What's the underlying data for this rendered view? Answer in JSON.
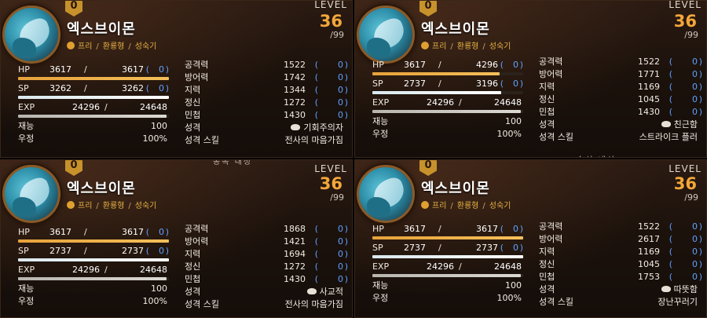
{
  "panels": [
    {
      "name": "엑스브이몬",
      "badge": "0",
      "tags": [
        "프리",
        "환룡형",
        "성숙기"
      ],
      "level_label": "LEVEL",
      "level": "36",
      "level_max": "/99",
      "hp": {
        "label": "HP",
        "cur": "3617",
        "max": "3617",
        "plus": "0",
        "fill": 1.0
      },
      "sp": {
        "label": "SP",
        "cur": "3262",
        "max": "3262",
        "plus": "0",
        "fill": 1.0
      },
      "exp": {
        "label": "EXP",
        "cur": "24296",
        "max": "24648",
        "fill": 0.986
      },
      "talent": {
        "label": "재능",
        "value": "100"
      },
      "friendship": {
        "label": "우정",
        "value": "100%"
      },
      "stats": [
        {
          "label": "공격력",
          "value": "1522",
          "plus": "0"
        },
        {
          "label": "방어력",
          "value": "1742",
          "plus": "0"
        },
        {
          "label": "지력",
          "value": "1344",
          "plus": "0"
        },
        {
          "label": "정신",
          "value": "1272",
          "plus": "0"
        },
        {
          "label": "민첩",
          "value": "1430",
          "plus": "0"
        }
      ],
      "personality": {
        "label": "성격",
        "value": "기회주의자"
      },
      "personality_skill": {
        "label": "성격 스킬",
        "value": "전사의 마음가짐"
      },
      "footer_text": ""
    },
    {
      "name": "엑스브이몬",
      "badge": "0",
      "tags": [
        "프리",
        "환룡형",
        "성숙기"
      ],
      "level_label": "LEVEL",
      "level": "36",
      "level_max": "/99",
      "hp": {
        "label": "HP",
        "cur": "3617",
        "max": "4296",
        "plus": "0",
        "fill": 0.842
      },
      "sp": {
        "label": "SP",
        "cur": "2737",
        "max": "3196",
        "plus": "0",
        "fill": 0.856
      },
      "exp": {
        "label": "EXP",
        "cur": "24296",
        "max": "24648",
        "fill": 0.986
      },
      "talent": {
        "label": "재능",
        "value": "100"
      },
      "friendship": {
        "label": "우정",
        "value": "100%"
      },
      "stats": [
        {
          "label": "공격력",
          "value": "1522",
          "plus": "0"
        },
        {
          "label": "방어력",
          "value": "1771",
          "plus": "0"
        },
        {
          "label": "지력",
          "value": "1169",
          "plus": "0"
        },
        {
          "label": "정신",
          "value": "1045",
          "plus": "0"
        },
        {
          "label": "민첩",
          "value": "1430",
          "plus": "0"
        }
      ],
      "personality": {
        "label": "성격",
        "value": "친근함"
      },
      "personality_skill": {
        "label": "성격 스킬",
        "value": "스트라이크 플러"
      },
      "footer_text": "송선 내선"
    },
    {
      "name": "엑스브이몬",
      "badge": "0",
      "tags": [
        "프리",
        "환룡형",
        "성숙기"
      ],
      "level_label": "LEVEL",
      "level": "36",
      "level_max": "/99",
      "hp": {
        "label": "HP",
        "cur": "3617",
        "max": "3617",
        "plus": "0",
        "fill": 1.0
      },
      "sp": {
        "label": "SP",
        "cur": "2737",
        "max": "2737",
        "plus": "0",
        "fill": 1.0
      },
      "exp": {
        "label": "EXP",
        "cur": "24296",
        "max": "24648",
        "fill": 0.986
      },
      "talent": {
        "label": "재능",
        "value": "100"
      },
      "friendship": {
        "label": "우정",
        "value": "100%"
      },
      "stats": [
        {
          "label": "공격력",
          "value": "1868",
          "plus": "0"
        },
        {
          "label": "방어력",
          "value": "1421",
          "plus": "0"
        },
        {
          "label": "지력",
          "value": "1694",
          "plus": "0"
        },
        {
          "label": "정신",
          "value": "1272",
          "plus": "0"
        },
        {
          "label": "민첩",
          "value": "1430",
          "plus": "0"
        }
      ],
      "personality": {
        "label": "성격",
        "value": "사교적"
      },
      "personality_skill": {
        "label": "성격 스킬",
        "value": "전사의 마음가짐"
      },
      "footer_text": "종족 내성"
    },
    {
      "name": "엑스브이몬",
      "badge": "0",
      "tags": [
        "프리",
        "환룡형",
        "성숙기"
      ],
      "level_label": "LEVEL",
      "level": "36",
      "level_max": "/99",
      "hp": {
        "label": "HP",
        "cur": "3617",
        "max": "3617",
        "plus": "0",
        "fill": 1.0
      },
      "sp": {
        "label": "SP",
        "cur": "2737",
        "max": "2737",
        "plus": "0",
        "fill": 1.0
      },
      "exp": {
        "label": "EXP",
        "cur": "24296",
        "max": "24648",
        "fill": 0.986
      },
      "talent": {
        "label": "재능",
        "value": "100"
      },
      "friendship": {
        "label": "우정",
        "value": "100%"
      },
      "stats": [
        {
          "label": "공격력",
          "value": "1522",
          "plus": "0"
        },
        {
          "label": "방어력",
          "value": "2617",
          "plus": "0"
        },
        {
          "label": "지력",
          "value": "1169",
          "plus": "0"
        },
        {
          "label": "정신",
          "value": "1045",
          "plus": "0"
        },
        {
          "label": "민첩",
          "value": "1753",
          "plus": "0"
        }
      ],
      "personality": {
        "label": "성격",
        "value": "따뜻함"
      },
      "personality_skill": {
        "label": "성격 스킬",
        "value": "장난꾸러기"
      },
      "footer_text": ""
    }
  ],
  "colors": {
    "accent": "#f3a73a",
    "tag": "#e8b444",
    "bonus": "#5fa0ff",
    "hp_bar": "#e7a23a",
    "sp_bar": "#ffffff"
  },
  "icons": {
    "badge": "hexagon-badge-icon",
    "tag": "coin-icon",
    "personality": "mind-icon"
  }
}
